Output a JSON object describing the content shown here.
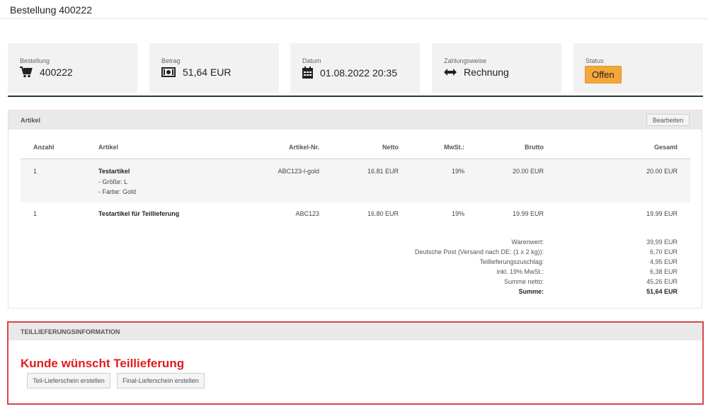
{
  "page": {
    "title": "Bestellung 400222"
  },
  "summary_cards": [
    {
      "label": "Bestellung",
      "value": "400222",
      "icon": "cart-icon"
    },
    {
      "label": "Betrag",
      "value": "51,64 EUR",
      "icon": "money-icon"
    },
    {
      "label": "Datum",
      "value": "01.08.2022 20:35",
      "icon": "calendar-icon"
    },
    {
      "label": "Zahlungsweise",
      "value": "Rechnung",
      "icon": "arrows-horizontal-icon"
    },
    {
      "label": "Status",
      "value": "Offen"
    }
  ],
  "colors": {
    "status_badge": "#f5a63a",
    "accent_line": "#1d3a3a",
    "alert_text": "#e31b1b",
    "highlight_border": "#d94545"
  },
  "articles": {
    "title": "Artikel",
    "edit_button": "Bearbeiten",
    "columns": [
      "Anzahl",
      "Artikel",
      "Artikel-Nr.",
      "Netto",
      "MwSt.:",
      "Brutto",
      "Gesamt"
    ],
    "rows": [
      {
        "qty": "1",
        "name": "Testartikel",
        "attributes": [
          "- Größe: L",
          "- Farbe: Gold"
        ],
        "sku": "ABC123-l-gold",
        "net": "16.81 EUR",
        "vat": "19%",
        "gross": "20.00 EUR",
        "total": "20.00 EUR"
      },
      {
        "qty": "1",
        "name": "Testartikel für Teillieferung",
        "attributes": [],
        "sku": "ABC123",
        "net": "16.80 EUR",
        "vat": "19%",
        "gross": "19.99 EUR",
        "total": "19.99 EUR"
      }
    ],
    "totals": [
      {
        "label": "Warenwert:",
        "value": "39,99 EUR"
      },
      {
        "label": "Deutsche Post (Versand nach DE: (1 x 2 kg)):",
        "value": "6,70 EUR"
      },
      {
        "label": "Teillieferungszuschlag:",
        "value": "4,95 EUR"
      },
      {
        "label": "inkl. 19% MwSt.:",
        "value": "6,38 EUR"
      },
      {
        "label": "Summe netto:",
        "value": "45,26 EUR"
      },
      {
        "label": "Summe:",
        "value": "51,64 EUR"
      }
    ]
  },
  "partial_delivery": {
    "title": "TEILLIEFERUNGSINFORMATION",
    "message": "Kunde wünscht Teillieferung",
    "buttons": [
      "Teil-Lieferschein erstellen",
      "Final-Lieferschein erstellen"
    ]
  }
}
